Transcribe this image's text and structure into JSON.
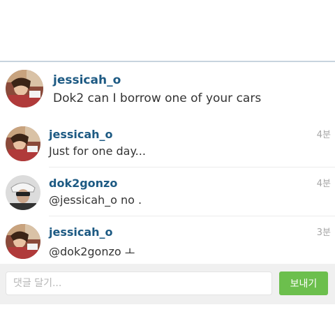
{
  "caption": {
    "username": "jessicah_o",
    "text": "Dok2 can I borrow one of your cars",
    "avatar_icon": "user-avatar-photo"
  },
  "comments": [
    {
      "username": "jessicah_o",
      "text": "Just for one day...",
      "time": "4분",
      "avatar_icon": "user-avatar-photo"
    },
    {
      "username": "dok2gonzo",
      "text": "@jessicah_o no .",
      "time": "4분",
      "avatar_icon": "user-avatar-photo"
    },
    {
      "username": "jessicah_o",
      "text": "@dok2gonzo ㅗ",
      "time": "3분",
      "avatar_icon": "user-avatar-photo"
    }
  ],
  "input": {
    "placeholder": "댓글 달기...",
    "send_label": "보내기"
  },
  "colors": {
    "username": "#1d5a83",
    "send_button": "#6cbf4d",
    "input_bar": "#f0f0f0"
  }
}
